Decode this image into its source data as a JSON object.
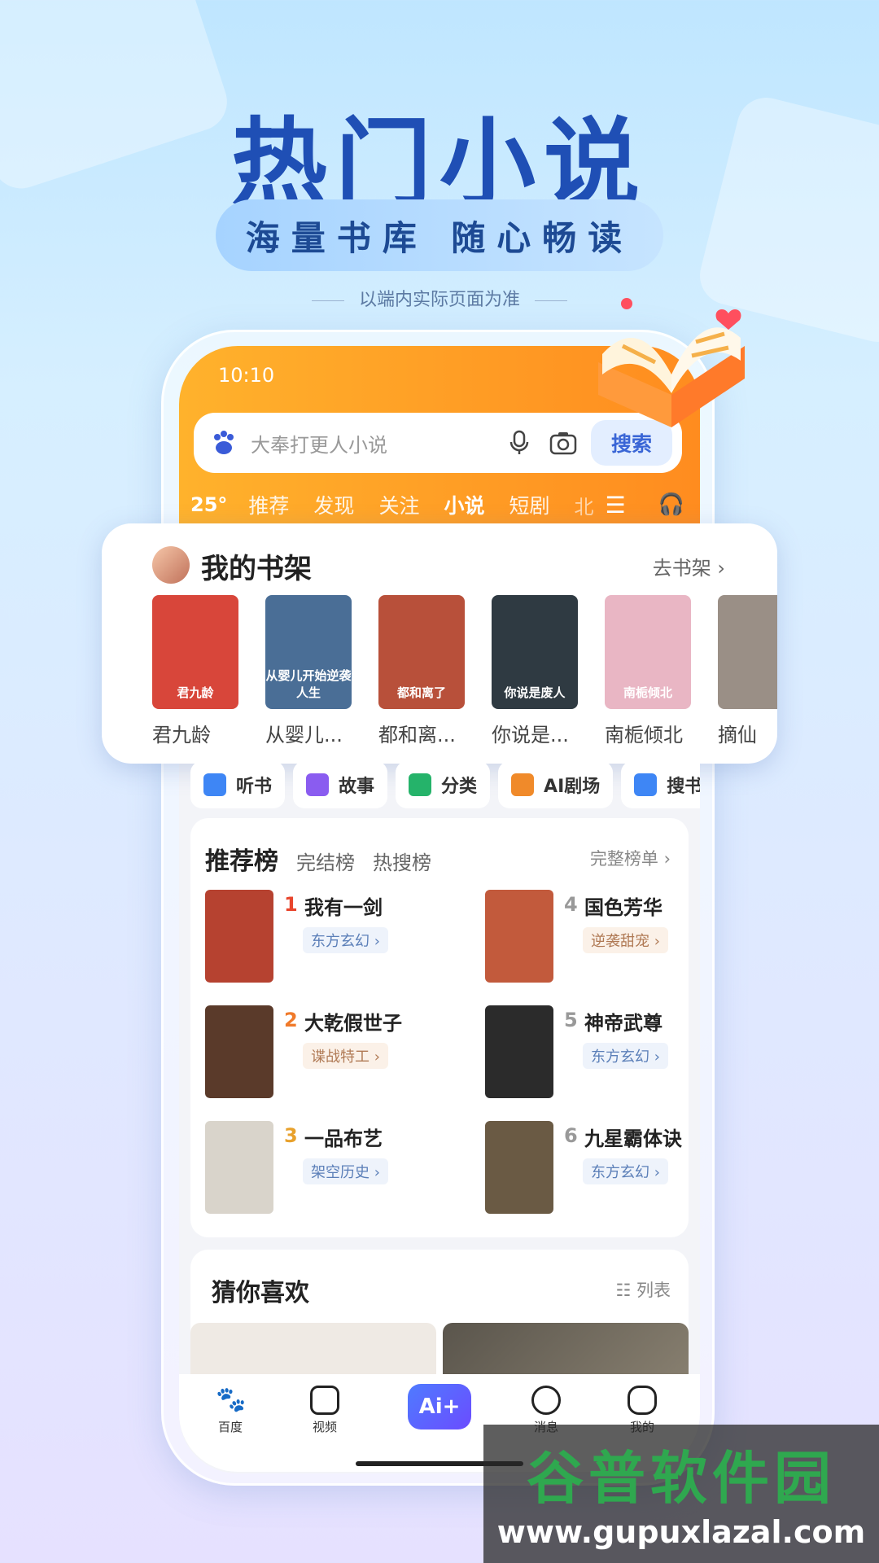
{
  "hero": {
    "title": "热门小说",
    "subtitle": "海量书库  随心畅读",
    "note": "以端内实际页面为准"
  },
  "status_bar": {
    "time": "10:10"
  },
  "search": {
    "placeholder": "大奉打更人小说",
    "button": "搜索"
  },
  "top_tabs": {
    "weather": "25°",
    "items": [
      "推荐",
      "发现",
      "关注",
      "小说",
      "短剧"
    ],
    "active": "小说",
    "overflow": "北"
  },
  "shelf": {
    "title": "我的书架",
    "go_label": "去书架 ›",
    "books": [
      {
        "name": "君九龄",
        "cover_text": "君九龄",
        "color": "#d8463a"
      },
      {
        "name": "从婴儿...",
        "cover_text": "从婴儿开始逆袭人生",
        "color": "#4a6e96"
      },
      {
        "name": "都和离...",
        "cover_text": "都和离了",
        "color": "#b8503a"
      },
      {
        "name": "你说是...",
        "cover_text": "你说是废人",
        "color": "#2f3a42"
      },
      {
        "name": "南栀倾北",
        "cover_text": "南栀倾北",
        "color": "#e9b6c4"
      },
      {
        "name": "摘仙",
        "cover_text": "",
        "color": "#9a8f86"
      }
    ]
  },
  "shortcuts": [
    {
      "label": "听书",
      "color": "#3e86f5"
    },
    {
      "label": "故事",
      "color": "#8a5cf0"
    },
    {
      "label": "分类",
      "color": "#25b36a"
    },
    {
      "label": "AI剧场",
      "color": "#f08a2a"
    },
    {
      "label": "搜书",
      "color": "#3e86f5"
    }
  ],
  "rank": {
    "title": "推荐榜",
    "tabs": [
      "完结榜",
      "热搜榜"
    ],
    "full_label": "完整榜单 ›",
    "items": [
      {
        "rank": "1",
        "name": "我有一剑",
        "tag": "东方玄幻 ›",
        "num_color": "#e8452c",
        "tag_color": "#5b7fb8",
        "tag_bg": "#eef3fb",
        "cover": "#b64230"
      },
      {
        "rank": "2",
        "name": "大乾假世子",
        "tag": "谍战特工 ›",
        "num_color": "#f07a2a",
        "tag_color": "#b07a55",
        "tag_bg": "#fbf1e8",
        "cover": "#5a3a2a"
      },
      {
        "rank": "3",
        "name": "一品布艺",
        "tag": "架空历史 ›",
        "num_color": "#e8a12c",
        "tag_color": "#5b7fb8",
        "tag_bg": "#eef3fb",
        "cover": "#d9d4cb"
      },
      {
        "rank": "4",
        "name": "国色芳华",
        "tag": "逆袭甜宠 ›",
        "num_color": "#999999",
        "tag_color": "#b07a55",
        "tag_bg": "#fbf1e8",
        "cover": "#c25a3c"
      },
      {
        "rank": "5",
        "name": "神帝武尊",
        "tag": "东方玄幻 ›",
        "num_color": "#999999",
        "tag_color": "#5b7fb8",
        "tag_bg": "#eef3fb",
        "cover": "#2b2b2b"
      },
      {
        "rank": "6",
        "name": "九星霸体诀",
        "tag": "东方玄幻 ›",
        "num_color": "#999999",
        "tag_color": "#5b7fb8",
        "tag_bg": "#eef3fb",
        "cover": "#6a5a44"
      }
    ]
  },
  "guess": {
    "title": "猜你喜欢",
    "list_label": "列表"
  },
  "bottom_tabs": [
    "百度",
    "视频",
    "消息",
    "我的"
  ],
  "ai_button": "Ai+",
  "watermark": {
    "brand": "谷普软件园",
    "url": "www.gupuxlazal.com"
  }
}
